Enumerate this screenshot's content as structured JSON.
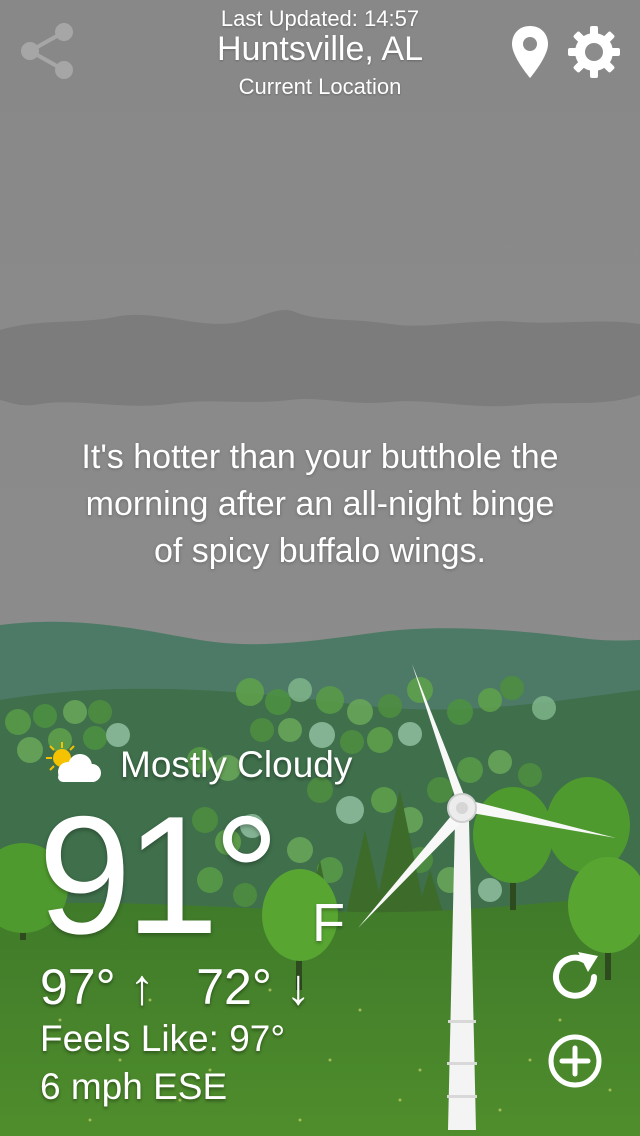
{
  "header": {
    "last_updated": "Last Updated: 14:57",
    "city": "Huntsville, AL",
    "location_label": "Current Location"
  },
  "quip": {
    "line1": "It's hotter than your butthole the",
    "line2": "morning after an all-night binge",
    "line3": "of spicy buffalo wings."
  },
  "weather": {
    "condition": "Mostly Cloudy",
    "condition_icon": "partly-cloudy-icon",
    "temperature": "91°",
    "unit": "F",
    "high": "97°",
    "high_arrow": "↑",
    "low": "72°",
    "low_arrow": "↓",
    "feels_like": "Feels Like: 97°",
    "wind": "6 mph ESE"
  },
  "icons": {
    "share": "share-icon",
    "location": "location-pin-icon",
    "settings": "gear-icon",
    "refresh": "refresh-icon",
    "add": "add-circle-icon"
  },
  "colors": {
    "sky": "#8c8c8c",
    "hill_far": "#3f6e5c",
    "grass": "#4f8a2c",
    "tree": "#4d9a2e"
  }
}
